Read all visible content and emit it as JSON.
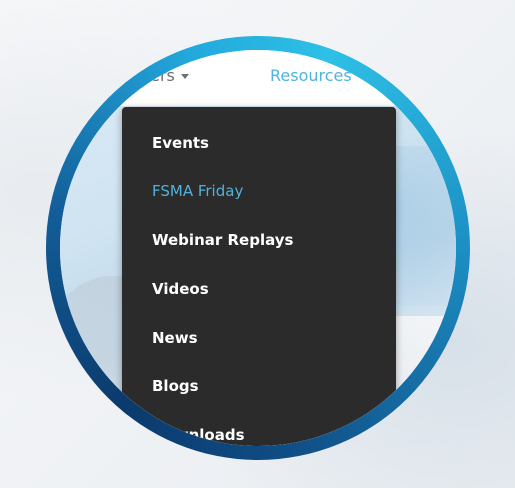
{
  "navbar": {
    "customers_label": "ustomers",
    "resources_label": "Resources"
  },
  "dropdown": {
    "items": [
      {
        "label": "Events",
        "active": false
      },
      {
        "label": "FSMA Friday",
        "active": true
      },
      {
        "label": "Webinar Replays",
        "active": false
      },
      {
        "label": "Videos",
        "active": false
      },
      {
        "label": "News",
        "active": false
      },
      {
        "label": "Blogs",
        "active": false
      },
      {
        "label": "Downloads",
        "active": false
      }
    ]
  },
  "colors": {
    "accent": "#4fb3dc",
    "menu_background": "#2b2b2b",
    "ring_light": "#2ec0e6",
    "ring_dark": "#0b3a6c"
  },
  "icons": {
    "nav_caret": "caret-down-icon"
  }
}
